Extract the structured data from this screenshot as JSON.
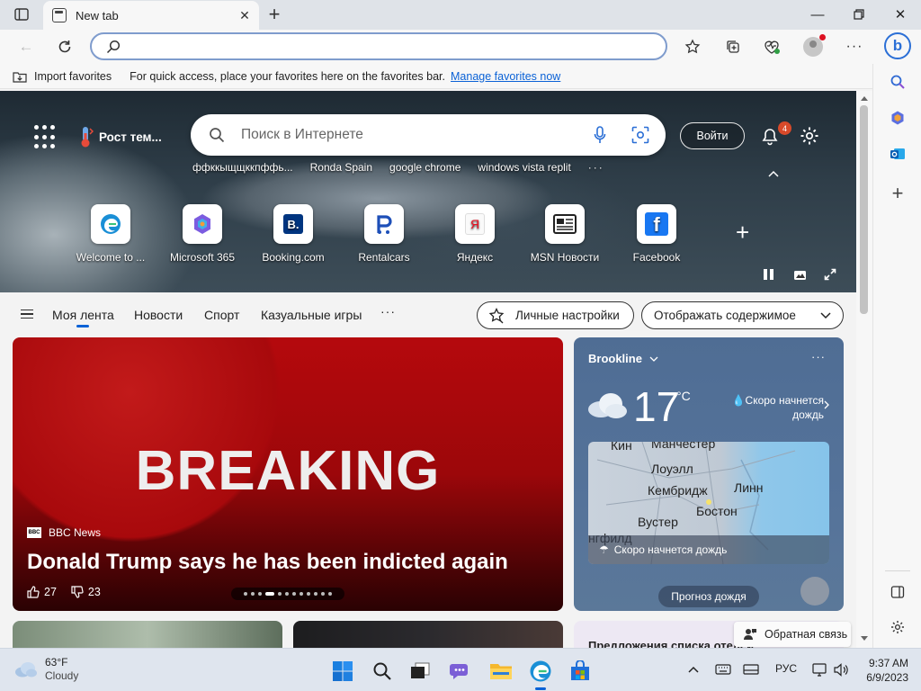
{
  "browser": {
    "tab_title": "New tab",
    "address_value": "",
    "colors": {
      "accent": "#0b62d6",
      "tab_strip": "#dfe3e8"
    }
  },
  "favorites_bar": {
    "import_label": "Import favorites",
    "hint_text": "For quick access, place your favorites here on the favorites bar.",
    "manage_link": "Manage favorites now"
  },
  "newtab": {
    "weather_chip": "Рост тем...",
    "search_placeholder": "Поиск в Интернете",
    "signin_label": "Войти",
    "notification_count": "4",
    "suggestions": [
      "ффккыщщккпффь...",
      "Ronda Spain",
      "google chrome",
      "windows vista replit"
    ],
    "quick_links": [
      {
        "label": "Welcome to ...",
        "icon": "edge-icon"
      },
      {
        "label": "Microsoft 365",
        "icon": "m365-icon"
      },
      {
        "label": "Booking.com",
        "icon": "booking-icon"
      },
      {
        "label": "Rentalcars",
        "icon": "rentalcars-icon"
      },
      {
        "label": "Яндекс",
        "icon": "yandex-icon"
      },
      {
        "label": "MSN Новости",
        "icon": "msn-news-icon"
      },
      {
        "label": "Facebook",
        "icon": "facebook-icon"
      }
    ]
  },
  "feed_nav": {
    "tabs": [
      "Моя лента",
      "Новости",
      "Спорт",
      "Казуальные игры"
    ],
    "personalize_label": "Личные настройки",
    "content_dropdown": "Отображать содержимое"
  },
  "hero_story": {
    "image_text": "BREAKING",
    "source": "BBC News",
    "source_logo": "BBC",
    "headline": "Donald Trump says he has been indicted again",
    "likes": "27",
    "dislikes": "23",
    "carousel_index": 4,
    "carousel_count": 12
  },
  "weather_card": {
    "location": "Brookline",
    "temperature": "17",
    "unit": "°C",
    "forecast": "Скоро начнется дождь",
    "map_cities": [
      "Кин",
      "Манчестер",
      "Лоуэлл",
      "Кембридж",
      "Линн",
      "Вустер",
      "Бостон",
      "нгфилд"
    ],
    "map_caption": "Скоро начнется дождь",
    "rain_button": "Прогноз дождя"
  },
  "lower_card_text": "Предложения списка отелей",
  "feedback_label": "Обратная связь",
  "taskbar": {
    "temp": "63°F",
    "condition": "Cloudy",
    "language": "РУС",
    "time": "9:37 AM",
    "date": "6/9/2023"
  }
}
